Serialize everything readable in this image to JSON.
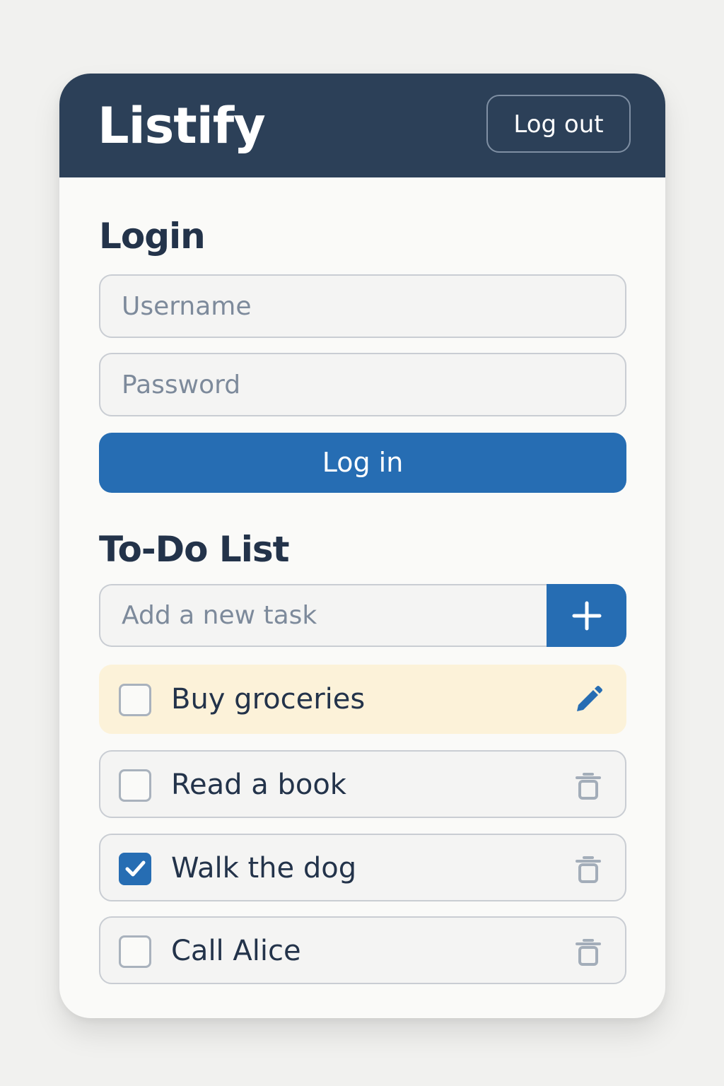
{
  "app": {
    "name": "Listify",
    "logout_label": "Log out"
  },
  "login": {
    "title": "Login",
    "username_placeholder": "Username",
    "password_placeholder": "Password",
    "button_label": "Log in"
  },
  "todo": {
    "title": "To-Do List",
    "add_placeholder": "Add a new task",
    "add_icon": "plus-icon",
    "tasks": [
      {
        "label": "Buy groceries",
        "checked": false,
        "highlighted": true,
        "action_icon": "pencil-icon"
      },
      {
        "label": "Read a book",
        "checked": false,
        "highlighted": false,
        "action_icon": "trash-icon"
      },
      {
        "label": "Walk the dog",
        "checked": true,
        "highlighted": false,
        "action_icon": "trash-icon"
      },
      {
        "label": "Call Alice",
        "checked": false,
        "highlighted": false,
        "action_icon": "trash-icon"
      }
    ]
  },
  "colors": {
    "header_bg": "#2c4058",
    "primary": "#266db3",
    "text_dark": "#23334a",
    "highlight_row": "#fcf2d9",
    "page_bg": "#f1f1ef"
  }
}
